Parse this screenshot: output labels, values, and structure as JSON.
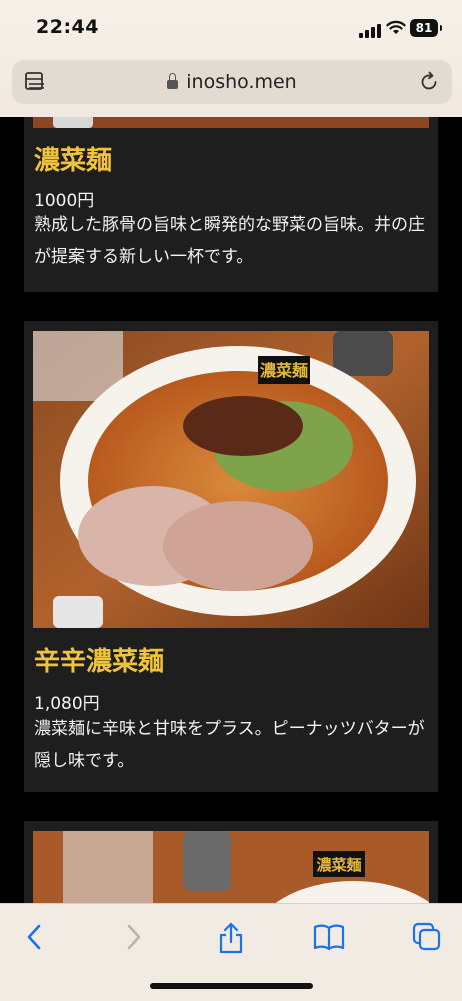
{
  "status": {
    "time": "22:44",
    "battery": "81"
  },
  "browser": {
    "url": "inosho.men"
  },
  "menu": [
    {
      "name": "濃菜麺",
      "price": "1000円",
      "description": "熟成した豚骨の旨味と瞬発的な野菜の旨味。井の庄が提案する新しい一杯です。"
    },
    {
      "name": "辛辛濃菜麺",
      "price": "1,080円",
      "description": "濃菜麺に辛味と甘味をプラス。ピーナッツバターが隠し味です。",
      "bowl_logo": "濃菜麺"
    },
    {
      "bowl_logo": "濃菜麺"
    }
  ],
  "colors": {
    "accent_gold": "#f0c43a",
    "card_bg": "#1e1e1e",
    "page_bg": "#000000",
    "ios_blue": "#1a73e8"
  },
  "toolbar": [
    "back-icon",
    "forward-icon",
    "share-icon",
    "bookmarks-icon",
    "tabs-icon"
  ]
}
